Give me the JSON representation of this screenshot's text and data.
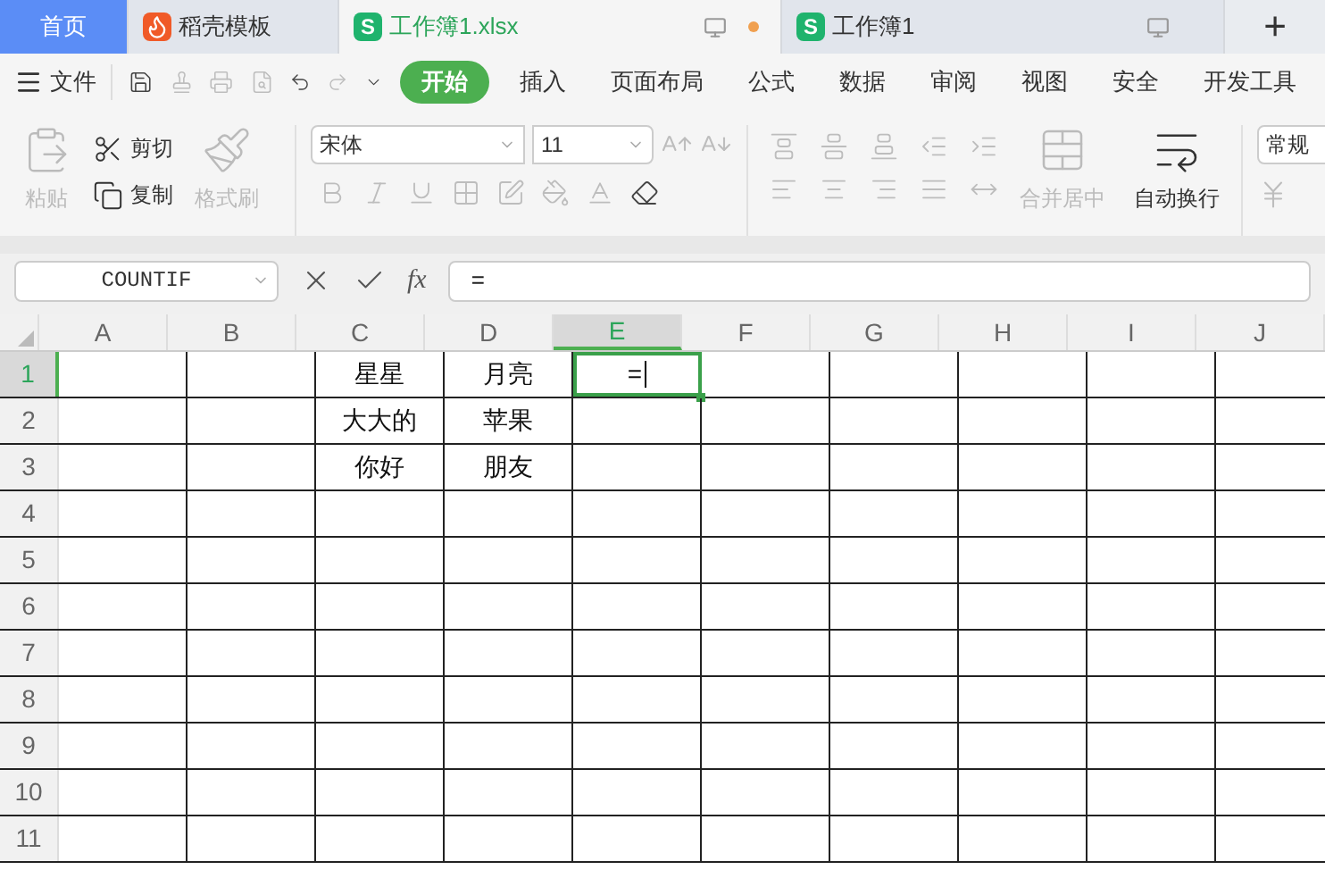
{
  "tabs": [
    {
      "kind": "home",
      "label": "首页",
      "selected": false
    },
    {
      "kind": "template",
      "label": "稻壳模板",
      "selected": false
    },
    {
      "kind": "sheet",
      "logo": "S",
      "label": "工作簿1.xlsx",
      "selected": true,
      "unsaved": true
    },
    {
      "kind": "sheet",
      "logo": "S",
      "label": "工作簿1",
      "selected": false,
      "unsaved": false
    }
  ],
  "new_tab": "+",
  "menu": {
    "file": "文件",
    "tabs": [
      {
        "label": "开始",
        "selected": true
      },
      {
        "label": "插入",
        "selected": false
      },
      {
        "label": "页面布局",
        "selected": false
      },
      {
        "label": "公式",
        "selected": false
      },
      {
        "label": "数据",
        "selected": false
      },
      {
        "label": "审阅",
        "selected": false
      },
      {
        "label": "视图",
        "selected": false
      },
      {
        "label": "安全",
        "selected": false
      },
      {
        "label": "开发工具",
        "selected": false
      }
    ]
  },
  "ribbon": {
    "paste": {
      "label": "粘贴",
      "disabled": true
    },
    "cut": {
      "label": "剪切",
      "disabled": false
    },
    "copy": {
      "label": "复制",
      "disabled": false
    },
    "format_painter": {
      "label": "格式刷",
      "disabled": true
    },
    "font": "宋体",
    "size": "11",
    "merge": {
      "label": "合并居中",
      "disabled": true
    },
    "wrap": {
      "label": "自动换行",
      "disabled": false
    },
    "number_format": "常规"
  },
  "formula_bar": {
    "name_box": "COUNTIF",
    "fx": "fx",
    "value": "="
  },
  "sheet": {
    "columns": [
      {
        "label": "A",
        "selected": false
      },
      {
        "label": "B",
        "selected": false
      },
      {
        "label": "C",
        "selected": false,
        "cells": [
          "星星",
          "大大的",
          "你好"
        ]
      },
      {
        "label": "D",
        "selected": false,
        "cells": [
          "月亮",
          "苹果",
          "朋友"
        ]
      },
      {
        "label": "E",
        "selected": true,
        "cells": [
          "="
        ]
      },
      {
        "label": "F",
        "selected": false
      },
      {
        "label": "G",
        "selected": false
      },
      {
        "label": "H",
        "selected": false
      },
      {
        "label": "I",
        "selected": false
      },
      {
        "label": "J",
        "selected": false
      }
    ],
    "rows": [
      {
        "label": "1",
        "selected": true
      },
      {
        "label": "2",
        "selected": false
      },
      {
        "label": "3",
        "selected": false
      },
      {
        "label": "4",
        "selected": false
      },
      {
        "label": "5",
        "selected": false
      },
      {
        "label": "6",
        "selected": false
      },
      {
        "label": "7",
        "selected": false
      },
      {
        "label": "8",
        "selected": false
      },
      {
        "label": "9",
        "selected": false
      },
      {
        "label": "10",
        "selected": false
      },
      {
        "label": "11",
        "selected": false
      }
    ]
  }
}
